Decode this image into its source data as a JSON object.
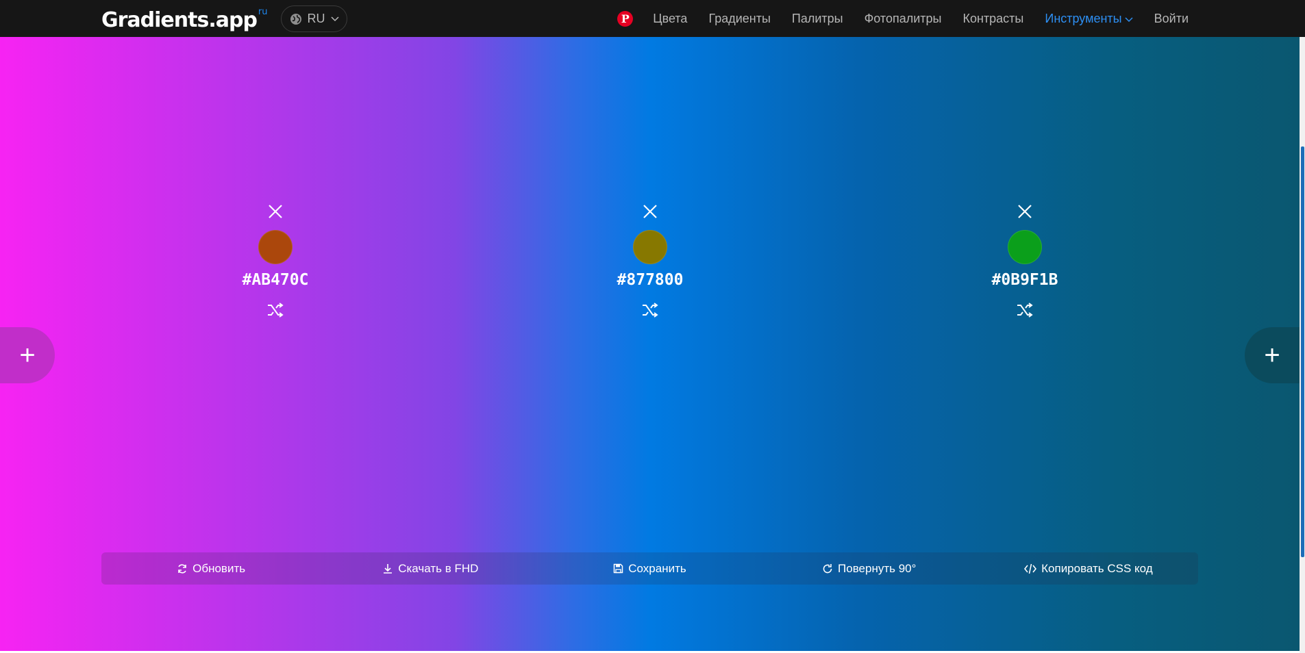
{
  "header": {
    "logo_text": "Gradients.app",
    "logo_sup": "ru",
    "language": "RU",
    "nav": [
      {
        "label": "Цвета"
      },
      {
        "label": "Градиенты"
      },
      {
        "label": "Палитры"
      },
      {
        "label": "Фотопалитры"
      },
      {
        "label": "Контрасты"
      },
      {
        "label": "Инструменты",
        "active": true
      },
      {
        "label": "Войти"
      }
    ],
    "accent_color": "#2d8ff3",
    "pinterest_color": "#e60023"
  },
  "gradient": {
    "colors": [
      "#f723f3",
      "#017ae2",
      "#0a5770"
    ],
    "direction": "90deg"
  },
  "color_stops": [
    {
      "hex": "#AB470C",
      "swatch": "#ab470c"
    },
    {
      "hex": "#877800",
      "swatch": "#877800"
    },
    {
      "hex": "#0B9F1B",
      "swatch": "#0b9f1b"
    }
  ],
  "toolbar": {
    "refresh": "Обновить",
    "download": "Скачать в FHD",
    "save": "Сохранить",
    "rotate": "Повернуть 90°",
    "copy_css": "Копировать CSS код"
  },
  "add_button_label": "+"
}
